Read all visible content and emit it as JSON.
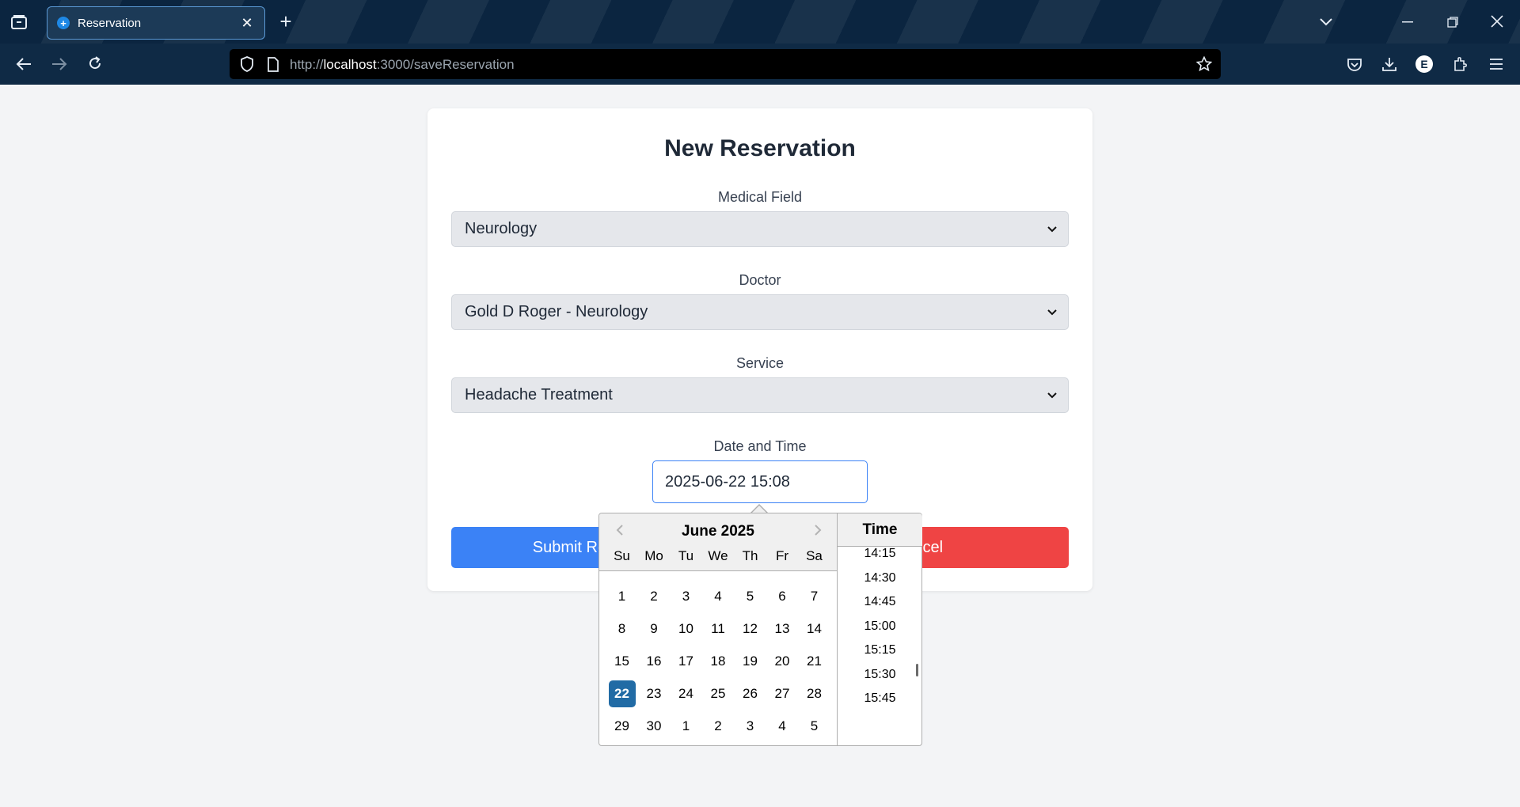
{
  "browser": {
    "tab_title": "Reservation",
    "new_tab_label": "+",
    "url_prefix": "http://",
    "url_host": "localhost",
    "url_rest": ":3000/saveReservation",
    "profile_initial": "E"
  },
  "form": {
    "title": "New Reservation",
    "medical_field": {
      "label": "Medical Field",
      "value": "Neurology"
    },
    "doctor": {
      "label": "Doctor",
      "value": "Gold D Roger - Neurology"
    },
    "service": {
      "label": "Service",
      "value": "Headache Treatment"
    },
    "datetime": {
      "label": "Date and Time",
      "value": "2025-06-22 15:08"
    },
    "submit_label": "Submit Reservation",
    "cancel_label": "Cancel"
  },
  "datepicker": {
    "month_label": "June 2025",
    "weekdays": [
      "Su",
      "Mo",
      "Tu",
      "We",
      "Th",
      "Fr",
      "Sa"
    ],
    "weeks": [
      [
        "1",
        "2",
        "3",
        "4",
        "5",
        "6",
        "7"
      ],
      [
        "8",
        "9",
        "10",
        "11",
        "12",
        "13",
        "14"
      ],
      [
        "15",
        "16",
        "17",
        "18",
        "19",
        "20",
        "21"
      ],
      [
        "22",
        "23",
        "24",
        "25",
        "26",
        "27",
        "28"
      ],
      [
        "29",
        "30",
        "1",
        "2",
        "3",
        "4",
        "5"
      ]
    ],
    "selected_day": "22",
    "time_header": "Time",
    "times": [
      "14:15",
      "14:30",
      "14:45",
      "15:00",
      "15:15",
      "15:30",
      "15:45"
    ]
  },
  "colors": {
    "accent": "#3b82f6",
    "danger": "#ef4444",
    "selected_day": "#216ba5"
  }
}
